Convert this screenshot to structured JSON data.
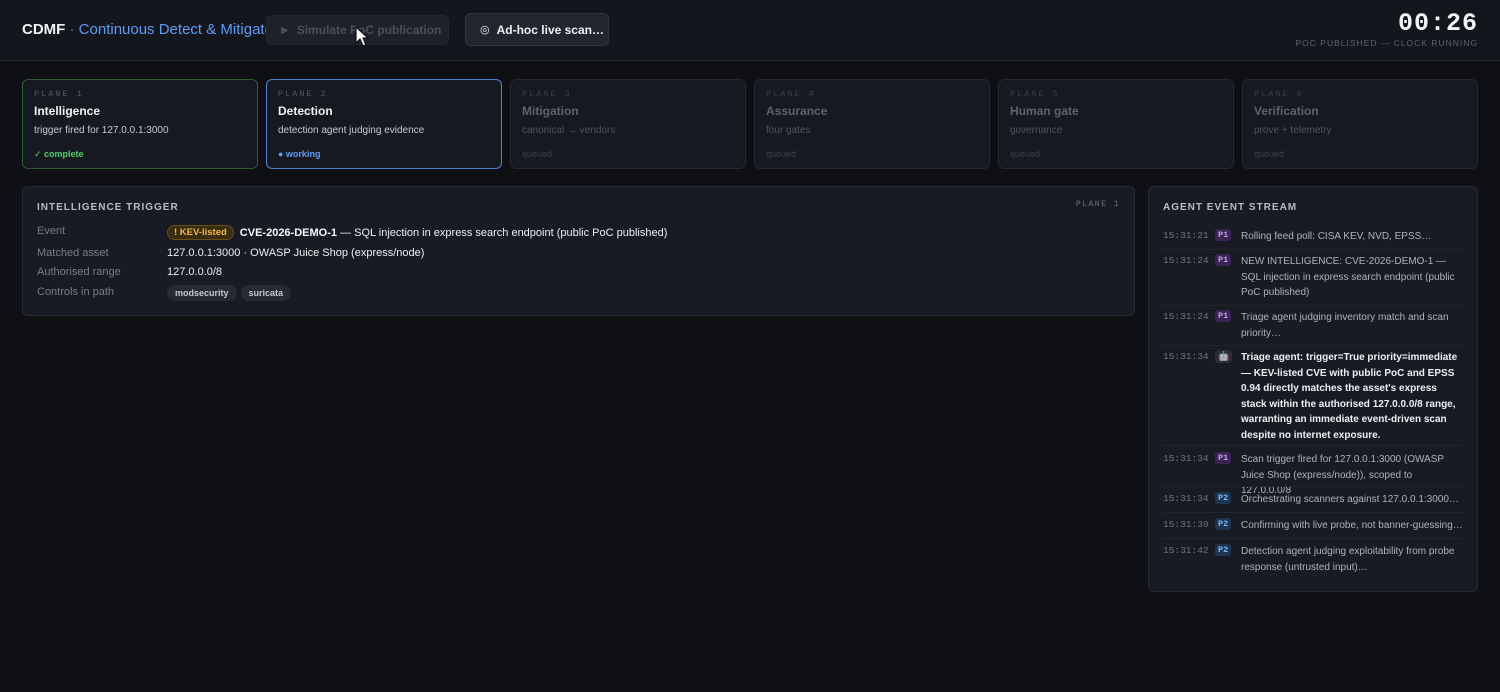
{
  "header": {
    "brand_short": "CDMF",
    "brand_sep": " · ",
    "brand_long": "Continuous Detect & Mitigate",
    "simulate_label": "Simulate PoC publication",
    "adhoc_label": "Ad-hoc live scan…",
    "clock_time": "00:26",
    "clock_status": "POC PUBLISHED — CLOCK RUNNING"
  },
  "planes": [
    {
      "num": "PLANE 1",
      "title": "Intelligence",
      "desc": "trigger fired for 127.0.0.1:3000",
      "status": "✓ complete"
    },
    {
      "num": "PLANE 2",
      "title": "Detection",
      "desc": "detection agent judging evidence",
      "status": "● working"
    },
    {
      "num": "PLANE 3",
      "title": "Mitigation",
      "desc": "canonical → vendors",
      "status": "queued"
    },
    {
      "num": "PLANE 4",
      "title": "Assurance",
      "desc": "four gates",
      "status": "queued"
    },
    {
      "num": "PLANE 5",
      "title": "Human gate",
      "desc": "governance",
      "status": "queued"
    },
    {
      "num": "PLANE 6",
      "title": "Verification",
      "desc": "prove + telemetry",
      "status": "queued"
    }
  ],
  "intel": {
    "title": "INTELLIGENCE TRIGGER",
    "plane_tag": "PLANE 1",
    "event_label": "Event",
    "kev_badge": "! KEV-listed",
    "cve_id": "CVE-2026-DEMO-1",
    "event_desc": " — SQL injection in express search endpoint (public PoC published)",
    "asset_label": "Matched asset",
    "asset_value": "127.0.0.1:3000 · OWASP Juice Shop (express/node)",
    "range_label": "Authorised range",
    "range_value": "127.0.0.0/8",
    "controls_label": "Controls in path",
    "controls": [
      "modsecurity",
      "suricata"
    ]
  },
  "stream": {
    "title": "AGENT EVENT STREAM",
    "events": [
      {
        "time": "15:31:21",
        "badge": "P1",
        "text": "Rolling feed poll: CISA KEV, NVD, EPSS…"
      },
      {
        "time": "15:31:24",
        "badge": "P1",
        "text": "NEW INTELLIGENCE: CVE-2026-DEMO-1 — SQL injection in express search endpoint (public PoC published)"
      },
      {
        "time": "15:31:24",
        "badge": "P1",
        "text": "Triage agent judging inventory match and scan priority…"
      },
      {
        "time": "15:31:34",
        "badge": "🤖",
        "text": "Triage agent: trigger=True priority=immediate — KEV-listed CVE with public PoC and EPSS 0.94 directly matches the asset's express stack within the authorised 127.0.0.0/8 range, warranting an immediate event-driven scan despite no internet exposure."
      },
      {
        "time": "15:31:34",
        "badge": "P1",
        "text": "Scan trigger fired for 127.0.0.1:3000 (OWASP Juice Shop (express/node)), scoped to 127.0.0.0/8"
      },
      {
        "time": "15:31:34",
        "badge": "P2",
        "text": "Orchestrating scanners against 127.0.0.1:3000…"
      },
      {
        "time": "15:31:39",
        "badge": "P2",
        "text": "Confirming with live probe, not banner-guessing…"
      },
      {
        "time": "15:31:42",
        "badge": "P2",
        "text": "Detection agent judging exploitability from probe response (untrusted input)…"
      }
    ]
  },
  "colors": {
    "accent": "#5b9cf5",
    "complete": "#4fcf6b",
    "kev": "#f2b83a",
    "p1": "#c89cf3",
    "p2": "#7fb5f2"
  }
}
